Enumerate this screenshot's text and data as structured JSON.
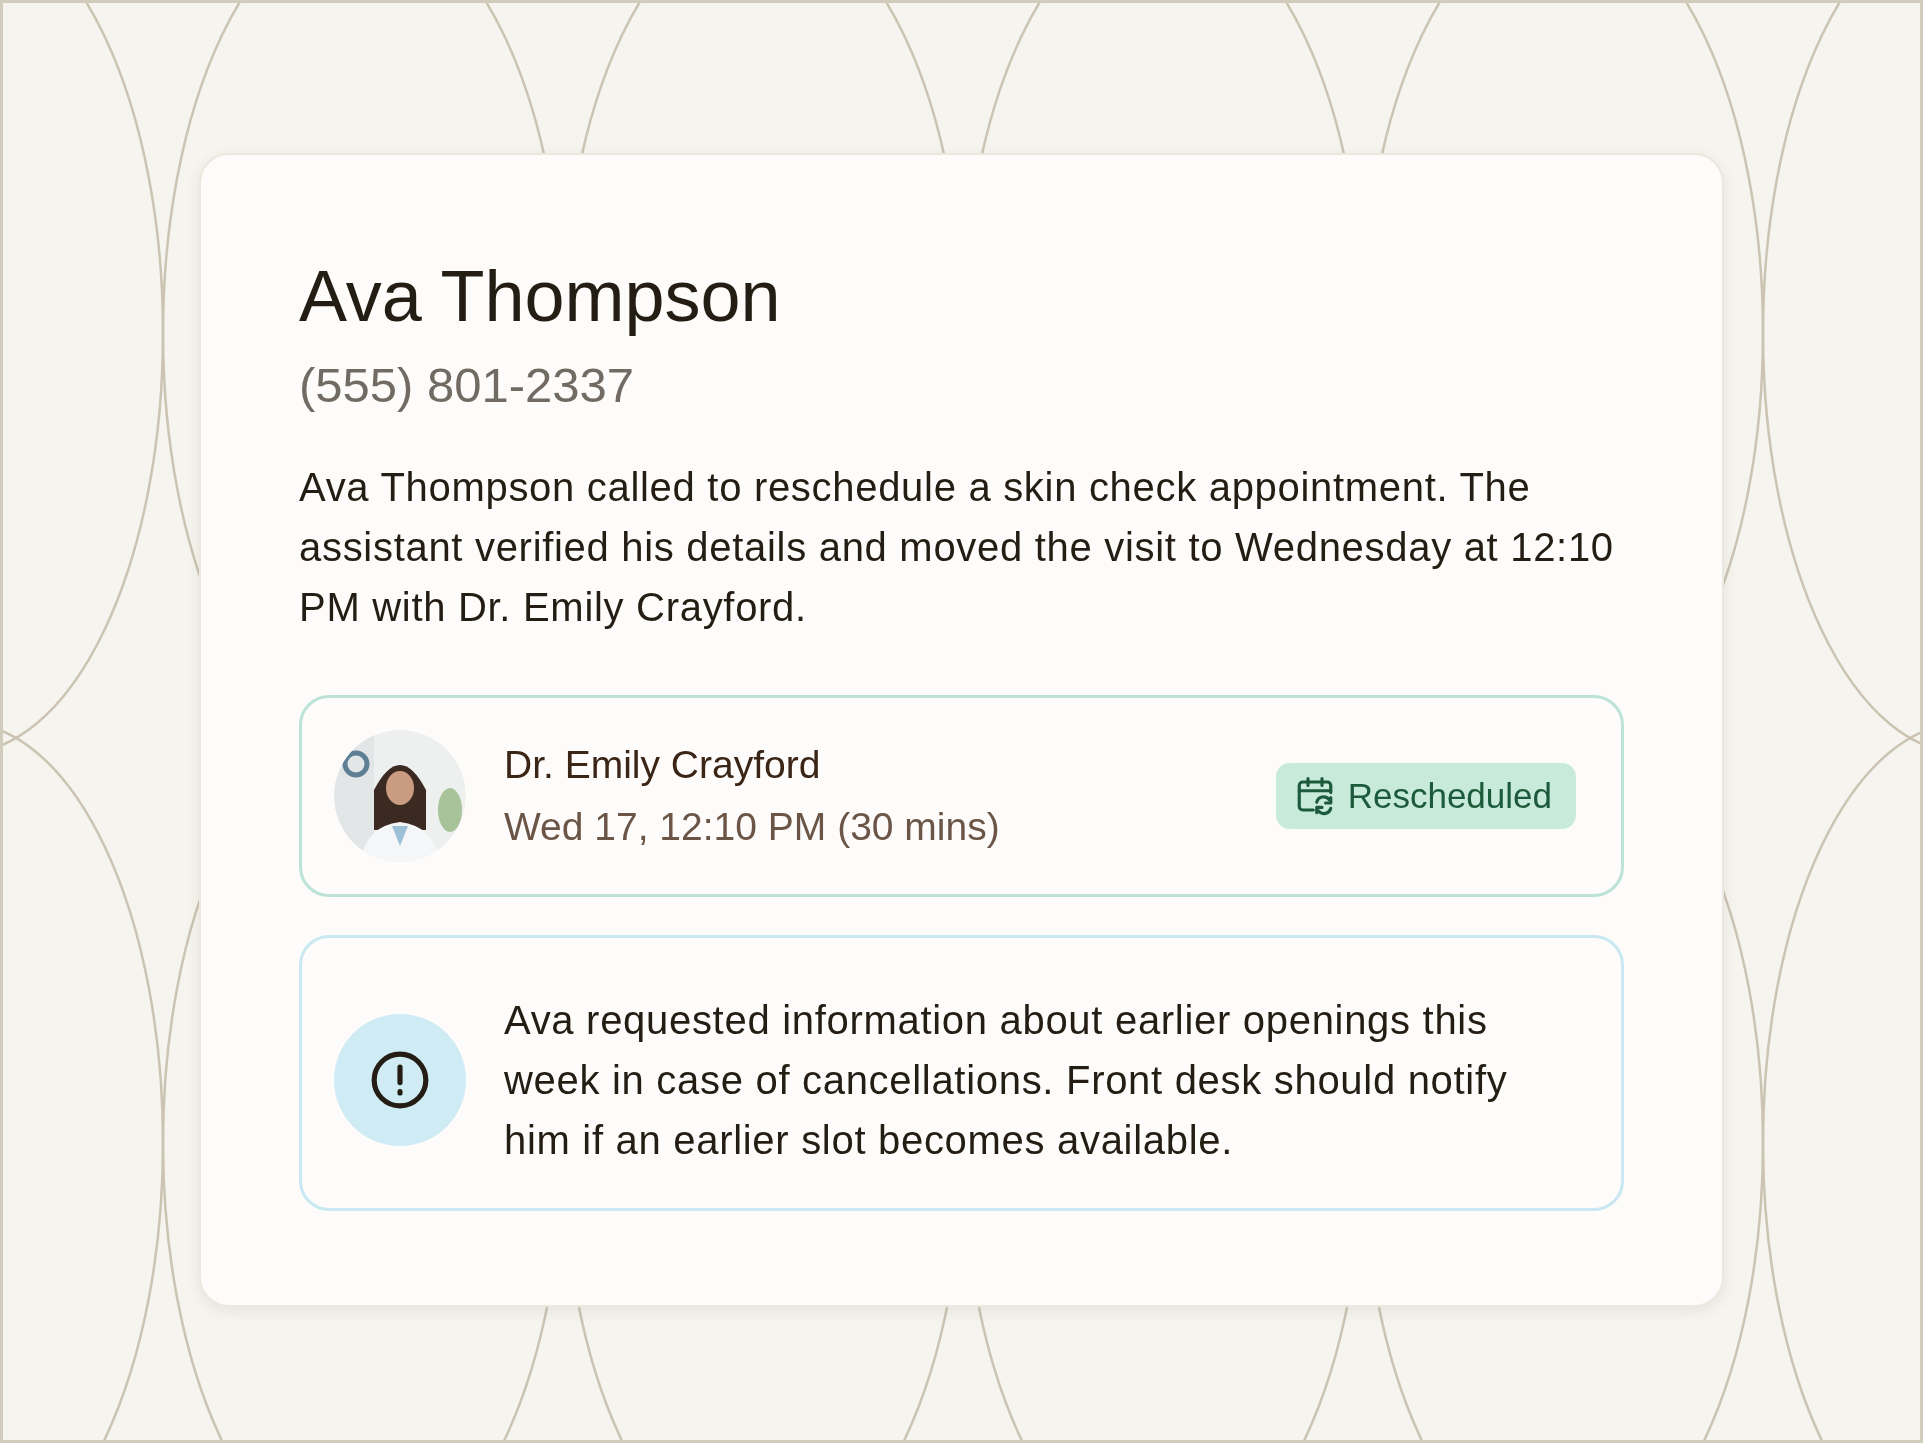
{
  "contact": {
    "name": "Ava Thompson",
    "phone": "(555) 801-2337"
  },
  "summary": "Ava Thompson called to reschedule a skin check appointment. The assistant verified his details and moved the visit to Wednesday at 12:10 PM with Dr. Emily Crayford.",
  "appointment": {
    "provider": "Dr. Emily Crayford",
    "time": "Wed 17, 12:10 PM (30 mins)",
    "status": {
      "kind": "rescheduled",
      "label": "Rescheduled"
    }
  },
  "note": {
    "kind": "alert",
    "text": "Ava requested information about earlier openings this week in case of cancellations. Front desk should notify him if an earlier slot becomes available."
  }
}
